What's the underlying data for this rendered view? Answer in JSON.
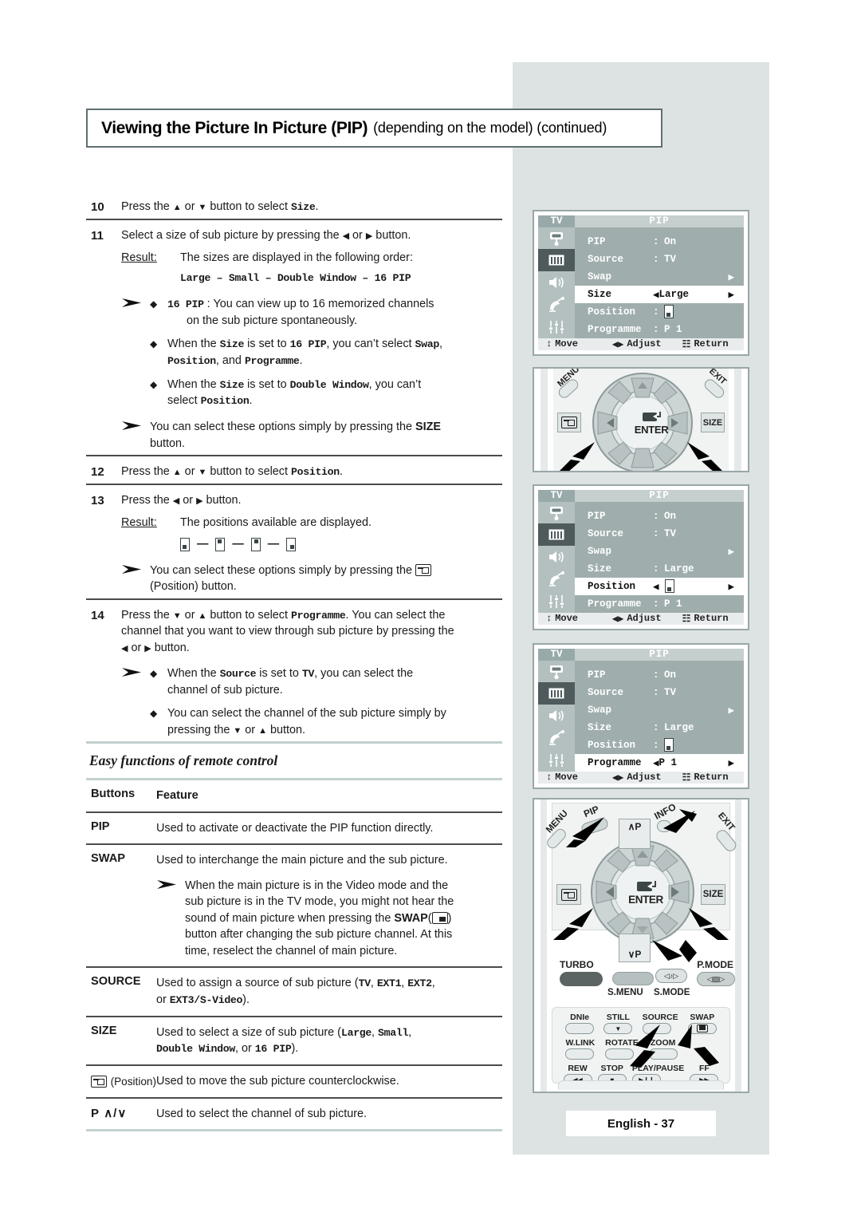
{
  "header": {
    "title_strong": "Viewing the Picture In Picture (PIP)",
    "title_rest": "(depending on the model) (continued)"
  },
  "steps": [
    {
      "num": "10",
      "text_parts": [
        "Press the ",
        "▲",
        " or ",
        "▼",
        " button to select ",
        "Size",
        "."
      ]
    },
    {
      "num": "11",
      "lead": "Select a size of sub picture by pressing the ◀ or ▶ button.",
      "result_label": "Result:",
      "result_text": "The sizes are displayed in the following order:",
      "order_line": "Large – Small – Double Window – 16 PIP",
      "notes": [
        "16 PIP : You can view up to 16 memorized channels on the sub picture spontaneously.",
        "When the Size is set to 16 PIP, you can’t select Swap, Position, and Programme.",
        "When the Size is set to Double Window, you can’t select Position.",
        "You can select these options simply by pressing the SIZE button."
      ]
    },
    {
      "num": "12",
      "lead": "Press the ▲ or ▼ button to select Position."
    },
    {
      "num": "13",
      "lead": "Press the ◀ or ▶ button.",
      "result_label": "Result:",
      "result_text": "The positions available are displayed.",
      "note": "You can select these options simply by pressing the (Position) button."
    },
    {
      "num": "14",
      "lead": "Press the ▼ or ▲ button to select Programme. You can select the channel that you want to view through sub picture by pressing the ◀ or ▶ button.",
      "notes": [
        "When the Source is set to TV, you can select the channel of sub picture.",
        "You can select the channel of the sub picture simply by pressing the ▼ or ▲ button."
      ]
    }
  ],
  "step10": {
    "pre": "Press the ",
    "mid": " or ",
    "post": " button to select ",
    "kw": "Size",
    "end": "."
  },
  "step11": {
    "lead_a": "Select a size of sub picture by pressing the ",
    "lead_b": " or ",
    "lead_c": " button.",
    "result_label": "Result:",
    "result_text": "The sizes are displayed in the following order:",
    "order_line": "Large – Small – Double Window – 16 PIP",
    "n1_kw": "16 PIP",
    "n1_colon": " : ",
    "n1_a": "You can view up to 16 memorized channels",
    "n1_b": "on the sub picture spontaneously.",
    "n2_a": "When the ",
    "n2_kw1": "Size",
    "n2_b": " is set to ",
    "n2_kw2": "16 PIP",
    "n2_c": ", you can’t select ",
    "n2_kw3": "Swap",
    "n2_d": ",",
    "n2_kw4": "Position",
    "n2_e": ", and ",
    "n2_kw5": "Programme",
    "n2_f": ".",
    "n3_a": "When the ",
    "n3_kw1": "Size",
    "n3_b": " is set to ",
    "n3_kw2": "Double Window",
    "n3_c": ", you can’t",
    "n3_d": "select ",
    "n3_kw3": "Position",
    "n3_e": ".",
    "n4_a": "You can select these options simply by pressing the ",
    "n4_kw": "SIZE",
    "n4_b": "button."
  },
  "step12": {
    "a": "Press the ",
    "b": " or ",
    "c": " button to select ",
    "kw": "Position",
    "d": "."
  },
  "step13": {
    "lead_a": "Press the ",
    "lead_b": " or ",
    "lead_c": " button.",
    "result_label": "Result:",
    "result_text": "The positions available are displayed.",
    "note_a": "You can select these options simply by pressing the ",
    "note_b": "(Position) button."
  },
  "step14": {
    "a": "Press the ",
    "b": " or ",
    "c": " button to select ",
    "kw": "Programme",
    "d": ". You can select the",
    "e": "channel that you want to view through sub picture by pressing the",
    "f": " or ",
    "g": " button.",
    "n1_a": "When the ",
    "n1_kw1": "Source",
    "n1_b": " is set to ",
    "n1_kw2": "TV",
    "n1_c": ", you can select the",
    "n1_d": "channel of sub picture.",
    "n2_a": "You can select the channel of the sub picture simply by",
    "n2_b": "pressing the ",
    "n2_c": " or ",
    "n2_d": " button."
  },
  "section": {
    "easy_functions_heading": "Easy functions of remote control"
  },
  "table": {
    "head_buttons": "Buttons",
    "head_feature": "Feature",
    "rows": [
      {
        "button": "PIP",
        "feature": "Used to activate or deactivate the PIP function directly."
      },
      {
        "button": "SWAP",
        "feature": "Used to interchange the main picture and the sub picture.",
        "note_a": "When the main picture is in the Video mode and the",
        "note_b": "sub picture is in the TV mode, you might not hear the",
        "note_c": "sound of main picture when pressing the ",
        "note_kw": "SWAP",
        "note_d": "button after changing the sub picture channel. At this",
        "note_e": "time, reselect the channel of main picture."
      },
      {
        "button": "SOURCE",
        "feat_a": "Used to assign a source of sub picture (",
        "feat_kw1": "TV",
        "feat_b": ", ",
        "feat_kw2": "EXT1",
        "feat_c": ", ",
        "feat_kw3": "EXT2",
        "feat_d": ",",
        "feat_e": "or ",
        "feat_kw4": "EXT3/S-Video",
        "feat_f": ")."
      },
      {
        "button": "SIZE",
        "feat_a": "Used to select a size of sub picture (",
        "feat_kw1": "Large",
        "feat_b": ", ",
        "feat_kw2": "Small",
        "feat_c": ",",
        "feat_kw3": "Double Window",
        "feat_d": ", or ",
        "feat_kw4": "16 PIP",
        "feat_e": ")."
      },
      {
        "button_suffix": "(Position)",
        "feature": "Used to move the sub picture counterclockwise."
      },
      {
        "button": "P",
        "button_suffix": "∧/∨",
        "feature": "Used to select the channel of sub picture."
      }
    ]
  },
  "osd_menus": [
    {
      "tv_label": "TV",
      "title": "PIP",
      "rows": [
        {
          "label": "PIP",
          "sep": ":",
          "value": "On",
          "selected": false,
          "arrow": false
        },
        {
          "label": "Source",
          "sep": ":",
          "value": "TV",
          "selected": false,
          "arrow": false
        },
        {
          "label": "Swap",
          "sep": "",
          "value": "",
          "selected": false,
          "arrow": true
        },
        {
          "label": "Size",
          "sep": "",
          "value": "Large",
          "selected": true,
          "arrow": true,
          "leftarrow": true
        },
        {
          "label": "Position",
          "sep": ":",
          "value": "[pos]",
          "selected": false,
          "arrow": false
        },
        {
          "label": "Programme",
          "sep": ":",
          "value": "P 1",
          "selected": false,
          "arrow": false
        }
      ],
      "move": "Move",
      "adjust": "Adjust",
      "return": "Return"
    },
    {
      "tv_label": "TV",
      "title": "PIP",
      "rows": [
        {
          "label": "PIP",
          "sep": ":",
          "value": "On",
          "selected": false,
          "arrow": false
        },
        {
          "label": "Source",
          "sep": ":",
          "value": "TV",
          "selected": false,
          "arrow": false
        },
        {
          "label": "Swap",
          "sep": "",
          "value": "",
          "selected": false,
          "arrow": true
        },
        {
          "label": "Size",
          "sep": ":",
          "value": "Large",
          "selected": false,
          "arrow": false
        },
        {
          "label": "Position",
          "sep": "",
          "value": "[pos]",
          "selected": true,
          "arrow": true,
          "leftarrow": true
        },
        {
          "label": "Programme",
          "sep": ":",
          "value": "P 1",
          "selected": false,
          "arrow": false
        }
      ],
      "move": "Move",
      "adjust": "Adjust",
      "return": "Return"
    },
    {
      "tv_label": "TV",
      "title": "PIP",
      "rows": [
        {
          "label": "PIP",
          "sep": ":",
          "value": "On",
          "selected": false,
          "arrow": false
        },
        {
          "label": "Source",
          "sep": ":",
          "value": "TV",
          "selected": false,
          "arrow": false
        },
        {
          "label": "Swap",
          "sep": "",
          "value": "",
          "selected": false,
          "arrow": true
        },
        {
          "label": "Size",
          "sep": ":",
          "value": "Large",
          "selected": false,
          "arrow": false
        },
        {
          "label": "Position",
          "sep": ":",
          "value": "[pos]",
          "selected": false,
          "arrow": false
        },
        {
          "label": "Programme",
          "sep": "",
          "value": "P 1",
          "selected": true,
          "arrow": true,
          "leftarrow": true
        }
      ],
      "move": "Move",
      "adjust": "Adjust",
      "return": "Return"
    }
  ],
  "remote": {
    "enter": "ENTER",
    "size": "SIZE",
    "menu": "MENU",
    "pip": "PIP",
    "info": "INFO",
    "exit": "EXIT",
    "ch_up": "∧P",
    "ch_down": "∨P",
    "turbo": "TURBO",
    "smenu": "S.MENU",
    "smode": "S.MODE",
    "pmode": "P.MODE",
    "keys": [
      [
        "DNIe",
        "STILL",
        "SOURCE",
        "SWAP"
      ],
      [
        "W.LINK",
        "ROTATE",
        "ZOOM",
        ""
      ],
      [
        "REW",
        "STOP",
        "PLAY/PAUSE",
        "FF"
      ]
    ]
  },
  "footer": {
    "page_label": "English - 37"
  },
  "colors": {
    "panel_gray": "#dde3e2",
    "osd_body": "#9fadad",
    "osd_title": "#c5cfce",
    "osd_tv": "#98a9aa",
    "rule_gray": "#c3d1cf",
    "border": "#5f6f72"
  }
}
